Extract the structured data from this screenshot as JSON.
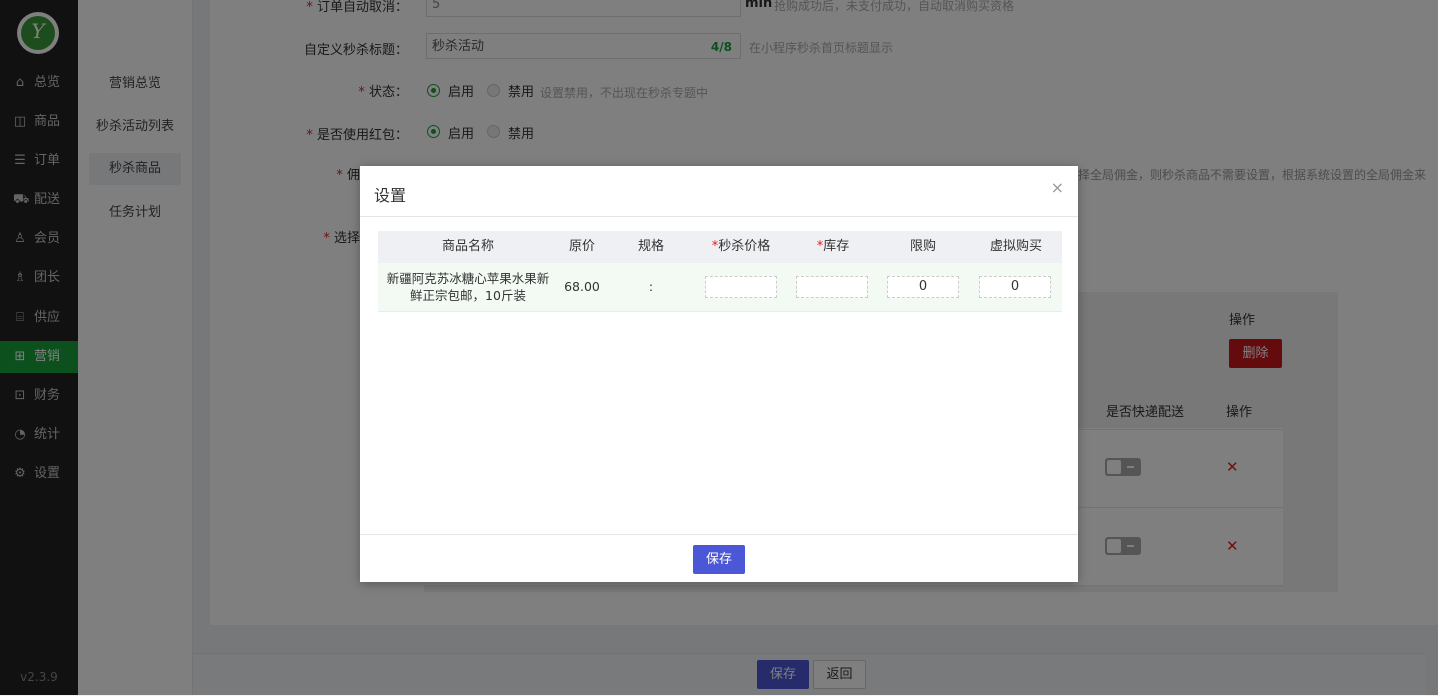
{
  "sidebar": {
    "logo_text": "Y",
    "items": [
      {
        "label": "总览",
        "icon": "home-icon",
        "glyph": "⌂"
      },
      {
        "label": "商品",
        "icon": "bag-icon",
        "glyph": "◫"
      },
      {
        "label": "订单",
        "icon": "order-icon",
        "glyph": "☰"
      },
      {
        "label": "配送",
        "icon": "delivery-icon",
        "glyph": "⛟"
      },
      {
        "label": "会员",
        "icon": "user-icon",
        "glyph": "♙"
      },
      {
        "label": "团长",
        "icon": "leader-icon",
        "glyph": "♗"
      },
      {
        "label": "供应",
        "icon": "supply-icon",
        "glyph": "⌸"
      },
      {
        "label": "营销",
        "icon": "gift-icon",
        "glyph": "⊞"
      },
      {
        "label": "财务",
        "icon": "finance-icon",
        "glyph": "⊡"
      },
      {
        "label": "统计",
        "icon": "stats-icon",
        "glyph": "◔"
      },
      {
        "label": "设置",
        "icon": "gear-icon",
        "glyph": "⚙"
      }
    ],
    "active": "营销",
    "version": "v2.3.9"
  },
  "subnav": {
    "items": [
      "营销总览",
      "秒杀活动列表",
      "秒杀商品",
      "任务计划"
    ],
    "active": "秒杀商品"
  },
  "form": {
    "auto_cancel": {
      "label": "订单自动取消：",
      "value": "5",
      "unit": "min",
      "hint": "抢购成功后，未支付成功，自动取消购买资格"
    },
    "title": {
      "label": "自定义秒杀标题：",
      "value": "秒杀活动",
      "count": "4/8",
      "hint": "在小程序秒杀首页标题显示"
    },
    "status": {
      "label": "状态：",
      "on": "启用",
      "off": "禁用",
      "hint": "设置禁用，不出现在秒杀专题中"
    },
    "redpack": {
      "label": "是否使用红包：",
      "on": "启用",
      "off": "禁用"
    },
    "commission": {
      "label": "佣",
      "hint": "择全局佣金，则秒杀商品不需要设置，根据系统设置的全局佣金来"
    },
    "select": {
      "label": "选择"
    }
  },
  "bg_table": {
    "op_header": "操作",
    "delete_label": "删除",
    "express_header": "是否快递配送",
    "op_header2": "操作",
    "x_glyph": "✕"
  },
  "footer": {
    "save": "保存",
    "back": "返回"
  },
  "modal": {
    "title": "设置",
    "close": "×",
    "columns": [
      {
        "label": "商品名称",
        "required": false
      },
      {
        "label": "原价",
        "required": false
      },
      {
        "label": "规格",
        "required": false
      },
      {
        "label": "秒杀价格",
        "required": true
      },
      {
        "label": "库存",
        "required": true
      },
      {
        "label": "限购",
        "required": false
      },
      {
        "label": "虚拟购买",
        "required": false
      }
    ],
    "row": {
      "name": "新疆阿克苏冰糖心苹果水果新鲜正宗包邮，10斤装",
      "price": "68.00",
      "spec": ":",
      "seckill_price": "",
      "stock": "",
      "limit": "0",
      "virtual": "0"
    },
    "save": "保存"
  },
  "colors": {
    "active_green": "#16a03a",
    "primary": "#4b57d6",
    "danger": "#c9161c"
  }
}
